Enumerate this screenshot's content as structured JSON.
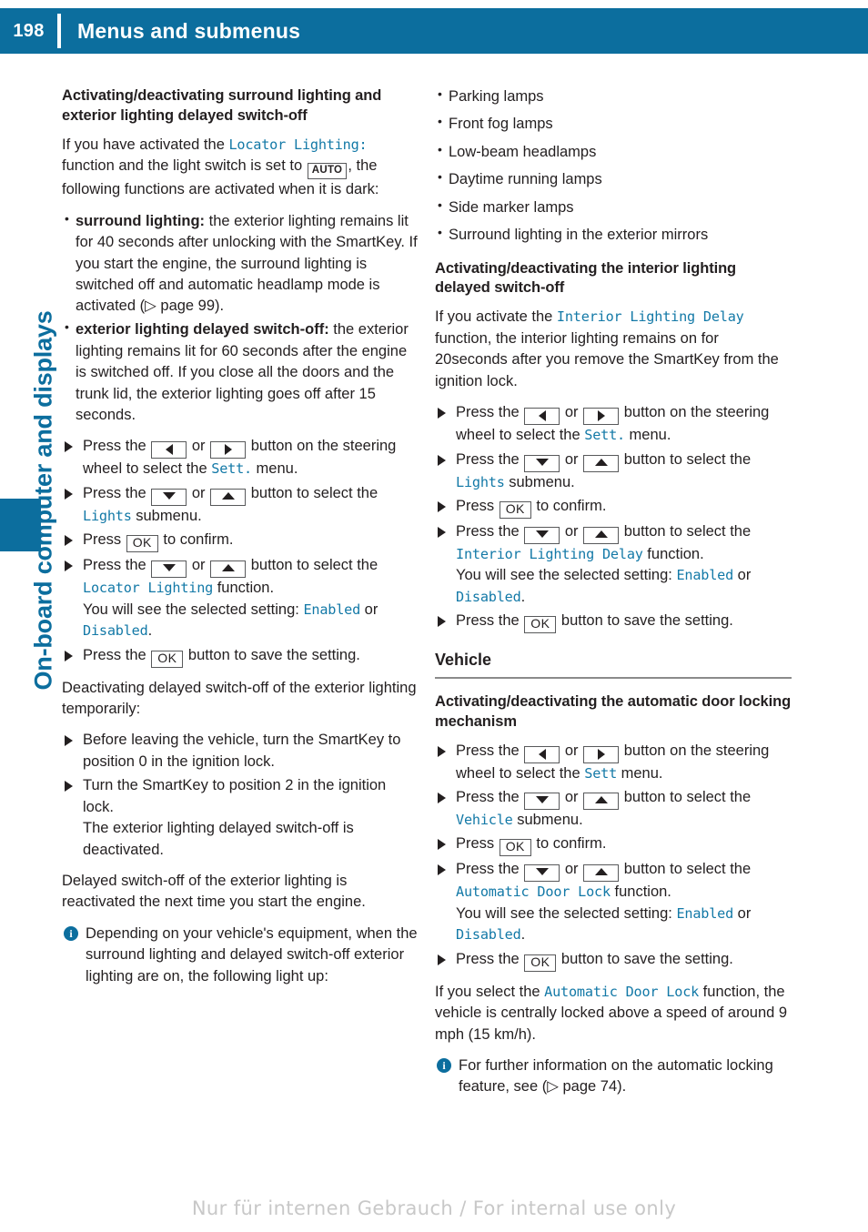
{
  "header": {
    "page_number": "198",
    "title": "Menus and submenus",
    "accent_color": "#0c6e9e"
  },
  "sidebar": {
    "chapter_title": "On-board computer and displays"
  },
  "footer": {
    "watermark": "Nur für internen Gebrauch / For internal use only"
  },
  "keys": {
    "left": "◀",
    "right": "▶",
    "down": "▼",
    "up": "▲",
    "ok": "OK",
    "auto": "AUTO"
  },
  "left_column": {
    "heading": "Activating/deactivating surround lighting and exterior lighting delayed switch-off",
    "intro": {
      "p1": "If you have activated the ",
      "fn_locator": "Locator Lighting:",
      "p2": " function and the light switch is set to ",
      "p3": ", the following functions are activated when it is dark:"
    },
    "bullets": [
      {
        "label": "surround lighting:",
        "text": " the exterior lighting remains lit for 40 seconds after unlocking with the SmartKey. If you start the engine, the surround lighting is switched off and automatic headlamp mode is activated (▷ page 99)."
      },
      {
        "label": "exterior lighting delayed switch-off:",
        "text": " the exterior lighting remains lit for 60 seconds after the engine is switched off. If you close all the doors and the trunk lid, the exterior lighting goes off after 15 seconds."
      }
    ],
    "steps": {
      "s1a": "Press the ",
      "s1b": " or ",
      "s1c": " button on the steering wheel to select the ",
      "s1_menu": "Sett.",
      "s1d": " menu.",
      "s2a": "Press the ",
      "s2b": " or ",
      "s2c": " button to select the ",
      "s2_menu": "Lights",
      "s2d": " submenu.",
      "s3a": "Press ",
      "s3b": " to confirm.",
      "s4c": " button to select the ",
      "s4_fn": "Locator Lighting",
      "s4d": " function.",
      "s4_setting_pre": "You will see the selected setting: ",
      "s4_enabled": "Enabled",
      "s4_or": " or ",
      "s4_disabled": "Disabled",
      "s4_dot": ".",
      "s5a": "Press the ",
      "s5b": " button to save the setting."
    },
    "deactivate_intro": "Deactivating delayed switch-off of the exterior lighting temporarily:",
    "deactivate_steps": [
      "Before leaving the vehicle, turn the SmartKey to position 0 in the ignition lock.",
      "Turn the SmartKey to position 2 in the ignition lock."
    ],
    "deactivate_step2_note": "The exterior lighting delayed switch-off is deactivated.",
    "reactivate_para": "Delayed switch-off of the exterior lighting is reactivated the next time you start the engine.",
    "note": "Depending on your vehicle's equipment, when the surround lighting and delayed switch-off exterior lighting are on, the following light up:"
  },
  "right_column": {
    "lamps": [
      "Parking lamps",
      "Front fog lamps",
      "Low-beam headlamps",
      "Daytime running lamps",
      "Side marker lamps",
      "Surround lighting in the exterior mirrors"
    ],
    "interior_heading": "Activating/deactivating the interior lighting delayed switch-off",
    "interior_intro": {
      "p1": "If you activate the ",
      "fn": "Interior Lighting Delay",
      "p2": " function, the interior lighting remains on for 20seconds after you remove the SmartKey from the ignition lock."
    },
    "interior_steps": {
      "s1a": "Press the ",
      "s1b": " or ",
      "s1c": " button on the steering wheel to select the ",
      "s1_menu": "Sett.",
      "s1d": " menu.",
      "s2c": " button to select the ",
      "s2_menu": "Lights",
      "s2d": " submenu.",
      "s3a": "Press ",
      "s3b": " to confirm.",
      "s4_fn": "Interior Lighting Delay",
      "s4d": " function.",
      "s4_setting_pre": "You will see the selected setting: ",
      "s4_enabled": "Enabled",
      "s4_or": " or ",
      "s4_disabled": "Disabled",
      "s4_dot": ".",
      "s5a": "Press the ",
      "s5b": " button to save the setting."
    },
    "vehicle_section": "Vehicle",
    "door_heading": "Activating/deactivating the automatic door locking mechanism",
    "door_steps": {
      "s1a": "Press the ",
      "s1b": " or ",
      "s1c": " button on the steering wheel to select the ",
      "s1_menu": "Sett",
      "s1d": " menu.",
      "s2c": " button to select the ",
      "s2_menu": "Vehicle",
      "s2d": " submenu.",
      "s3a": "Press ",
      "s3b": " to confirm.",
      "s4_fn": "Automatic Door Lock",
      "s4d": " function.",
      "s4_setting_pre": "You will see the selected setting: ",
      "s4_enabled": "Enabled",
      "s4_or": " or ",
      "s4_disabled": "Disabled",
      "s4_dot": ".",
      "s5a": "Press the ",
      "s5b": " button to save the setting."
    },
    "door_para": {
      "p1": "If you select the ",
      "fn": "Automatic Door Lock",
      "p2": " function, the vehicle is centrally locked above a speed of around 9 mph (15 km/h)."
    },
    "door_note": "For further information on the automatic locking feature, see (▷ page 74)."
  }
}
